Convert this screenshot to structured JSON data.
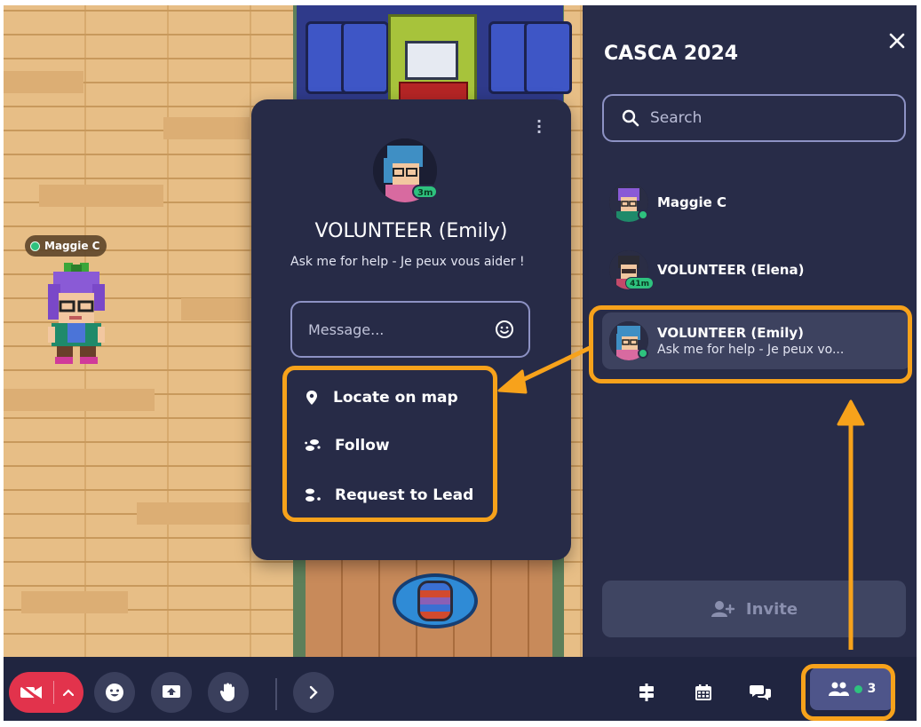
{
  "map": {
    "player_tag": {
      "name": "Maggie C",
      "status_color": "#2ec27e"
    }
  },
  "sidebar": {
    "title": "CASCA 2024",
    "close_icon": "close-icon",
    "search": {
      "placeholder": "Search",
      "icon": "search-icon"
    },
    "members": [
      {
        "name": "Maggie C",
        "subtitle": "",
        "status": "online",
        "badge": ""
      },
      {
        "name": "VOLUNTEER (Elena)",
        "subtitle": "",
        "status": "away",
        "badge": "41m"
      },
      {
        "name": "VOLUNTEER (Emily)",
        "subtitle": "Ask me for help - Je peux vo...",
        "status": "online",
        "badge": "",
        "selected": true
      }
    ],
    "invite_label": "Invite",
    "invite_icon": "add-person-icon"
  },
  "profile_card": {
    "name": "VOLUNTEER (Emily)",
    "time_badge": "3m",
    "description": "Ask me for help - Je peux vous aider !",
    "message_placeholder": "Message...",
    "emoji_icon": "smiley-icon",
    "more_icon": "more-vertical-icon",
    "actions": [
      {
        "label": "Locate on map",
        "icon": "map-pin-icon"
      },
      {
        "label": "Follow",
        "icon": "footsteps-icon"
      },
      {
        "label": "Request to Lead",
        "icon": "lead-icon"
      }
    ]
  },
  "bottom_bar": {
    "left_buttons": [
      "camera-off-icon",
      "chevron-up-icon",
      "emoji-icon",
      "screen-share-icon",
      "raise-hand-icon",
      "chevron-right-icon"
    ],
    "right_tools": [
      "signpost-icon",
      "calendar-icon",
      "chat-icon"
    ],
    "participants": {
      "icon": "people-icon",
      "count": "3",
      "status_color": "#2ec27e"
    }
  },
  "colors": {
    "sidebar_bg": "#282c48",
    "bottom_bar_bg": "#202540",
    "highlight": "#f7a21b",
    "online": "#2ec27e",
    "camera_off": "#e2334c"
  }
}
